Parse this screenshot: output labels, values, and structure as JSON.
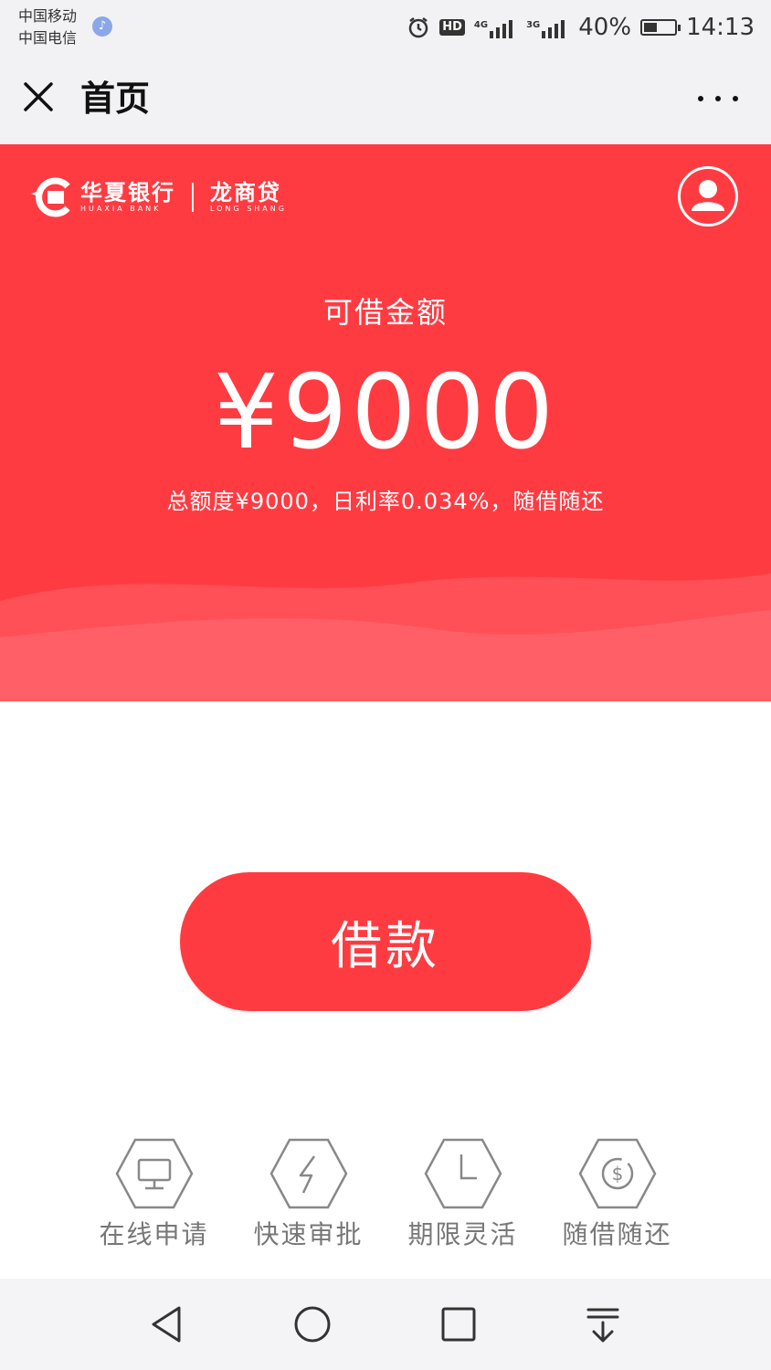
{
  "status_bar": {
    "carrier_1": "中国移动",
    "carrier_2": "中国电信",
    "network_1": "4G",
    "network_2": "3G",
    "hd": "HD",
    "battery": "40%",
    "time": "14:13",
    "icons": [
      "music-icon",
      "alarm-icon",
      "signal-icon",
      "battery-icon"
    ]
  },
  "nav": {
    "title": "首页",
    "close_icon": "close-icon",
    "more_icon": "more-icon"
  },
  "hero": {
    "brand_name": "华夏银行",
    "brand_en": "HUAXIA BANK",
    "product_name": "龙商贷",
    "product_en": "LONG SHANG",
    "label_available": "可借金额",
    "amount": "¥9000",
    "sub_info": "总额度¥9000，日利率0.034%，随借随还",
    "avatar_icon": "user-icon"
  },
  "borrow_button": "借款",
  "features": [
    {
      "label": "在线申请",
      "icon": "monitor-icon"
    },
    {
      "label": "快速审批",
      "icon": "lightning-icon"
    },
    {
      "label": "期限灵活",
      "icon": "clock-icon"
    },
    {
      "label": "随借随还",
      "icon": "coin-icon"
    }
  ],
  "system_nav": [
    "back-icon",
    "home-icon",
    "recents-icon",
    "notification-pull-icon"
  ],
  "colors": {
    "accent": "#ff3b42",
    "wave": "#ff6068",
    "feature_gray": "#777777"
  }
}
